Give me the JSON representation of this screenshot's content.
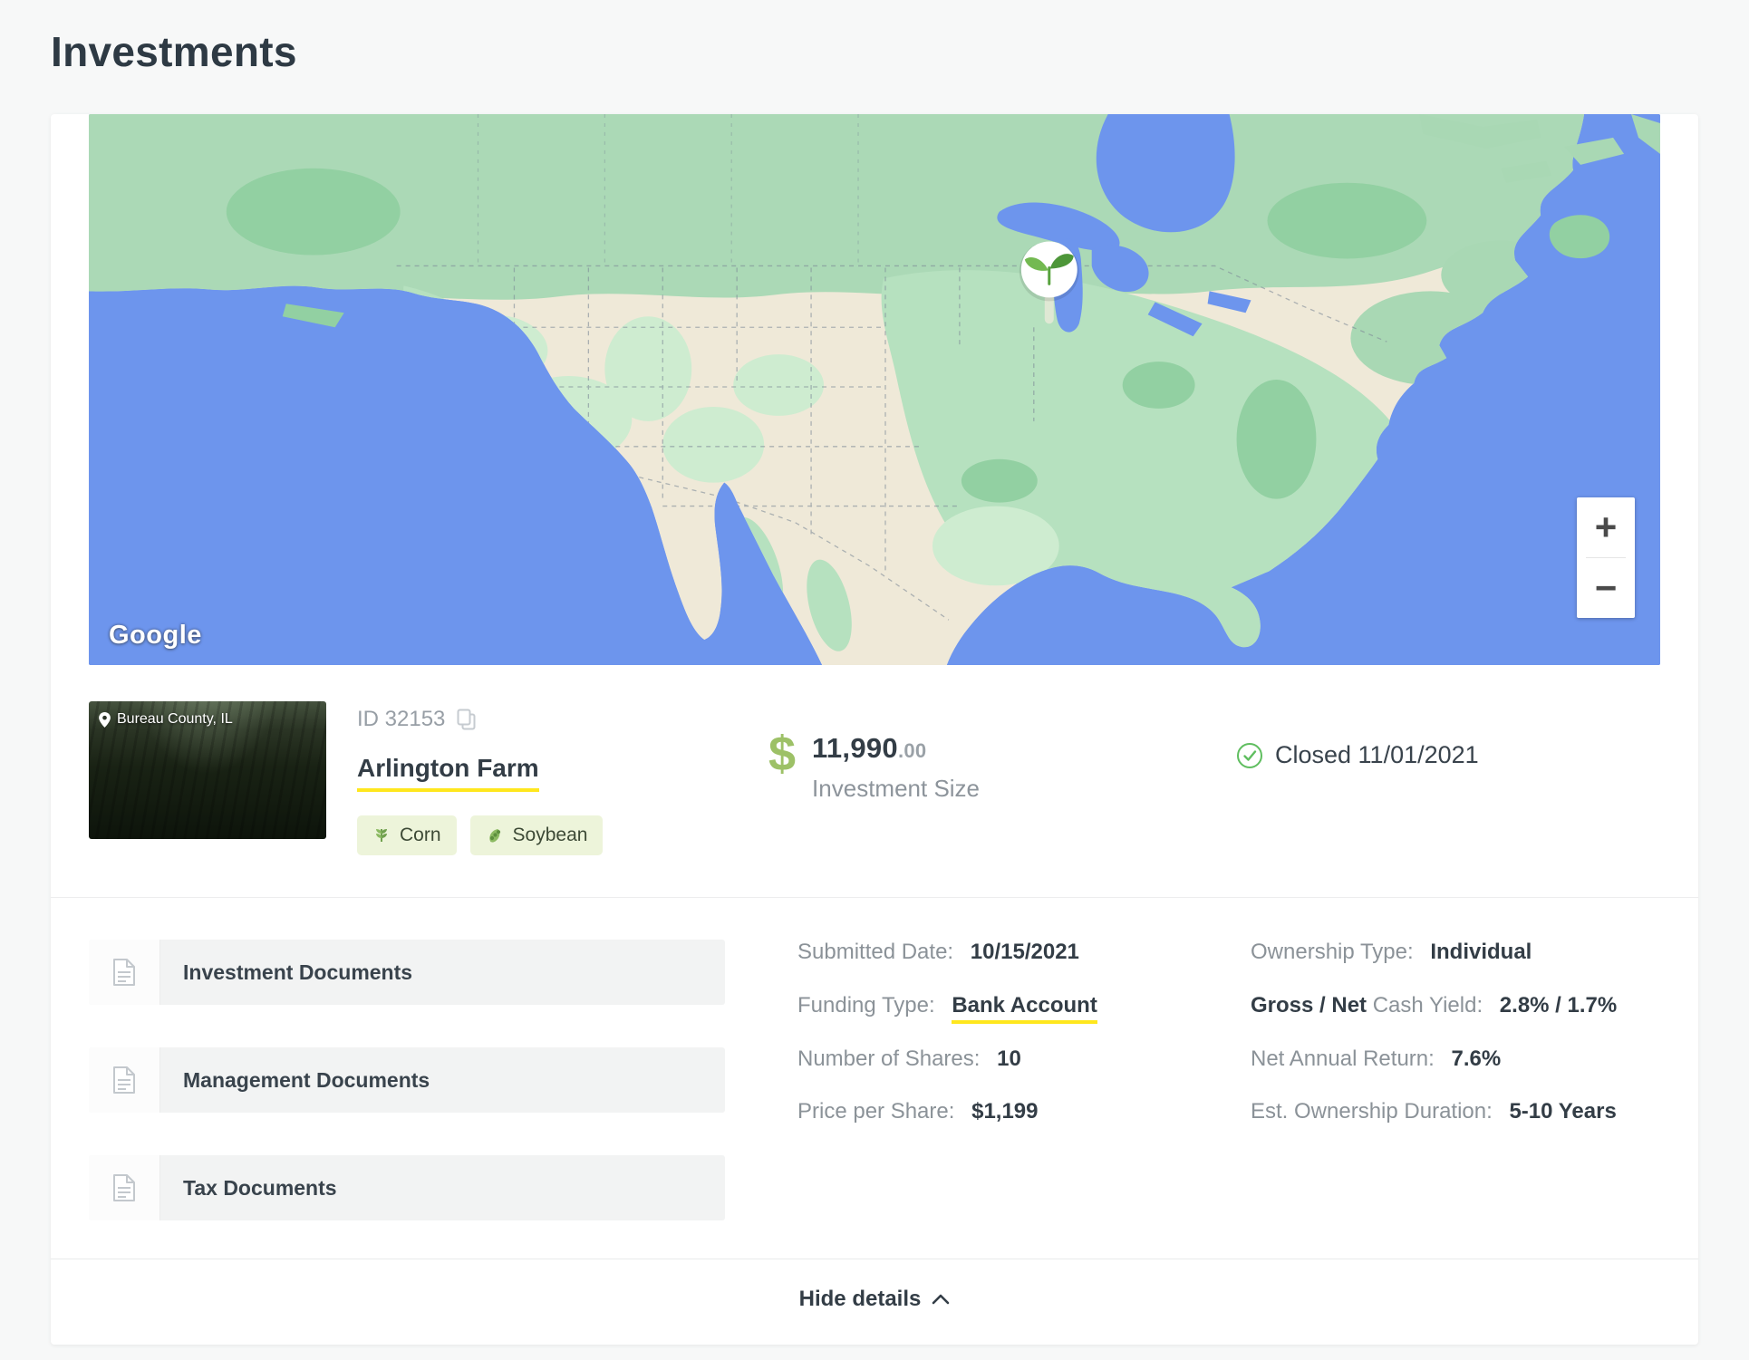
{
  "page": {
    "title": "Investments"
  },
  "colors": {
    "highlight_yellow": "#ffe71e",
    "status_green": "#5fbe5f",
    "tag_background": "#edf4da",
    "map_water": "#6d95ed"
  },
  "map": {
    "attribution": "Google",
    "zoom_in_label": "+",
    "zoom_out_label": "−",
    "marker_icon": "sprout-marker-icon"
  },
  "investment": {
    "location_label": "Bureau County, IL",
    "id_label": "ID 32153",
    "name": "Arlington Farm",
    "tags": [
      {
        "icon": "corn-icon",
        "label": "Corn"
      },
      {
        "icon": "soybean-icon",
        "label": "Soybean"
      }
    ],
    "size_currency": "$",
    "size_whole": "11,990",
    "size_cents": ".00",
    "size_label": "Investment Size",
    "status_icon": "check-circle-icon",
    "status": "Closed 11/01/2021"
  },
  "documents": [
    {
      "icon": "document-icon",
      "label": "Investment Documents"
    },
    {
      "icon": "document-icon",
      "label": "Management Documents"
    },
    {
      "icon": "document-icon",
      "label": "Tax Documents"
    }
  ],
  "details": {
    "left": [
      {
        "label_strong": "",
        "label": "Submitted Date:",
        "value": "10/15/2021"
      },
      {
        "label_strong": "",
        "label": "Funding Type:",
        "value": "Bank Account"
      },
      {
        "label_strong": "",
        "label": "Number of Shares:",
        "value": "10"
      },
      {
        "label_strong": "",
        "label": "Price per Share:",
        "value": "$1,199"
      }
    ],
    "right": [
      {
        "label_strong": "",
        "label": "Ownership Type:",
        "value": "Individual"
      },
      {
        "label_strong": "Gross / Net",
        "label": " Cash Yield:",
        "value": "2.8% / 1.7%"
      },
      {
        "label_strong": "",
        "label": "Net Annual Return:",
        "value": "7.6%"
      },
      {
        "label_strong": "",
        "label": "Est. Ownership Duration:",
        "value": "5-10 Years"
      }
    ]
  },
  "footer": {
    "hide_details_label": "Hide details",
    "chevron_icon": "chevron-up-icon"
  }
}
